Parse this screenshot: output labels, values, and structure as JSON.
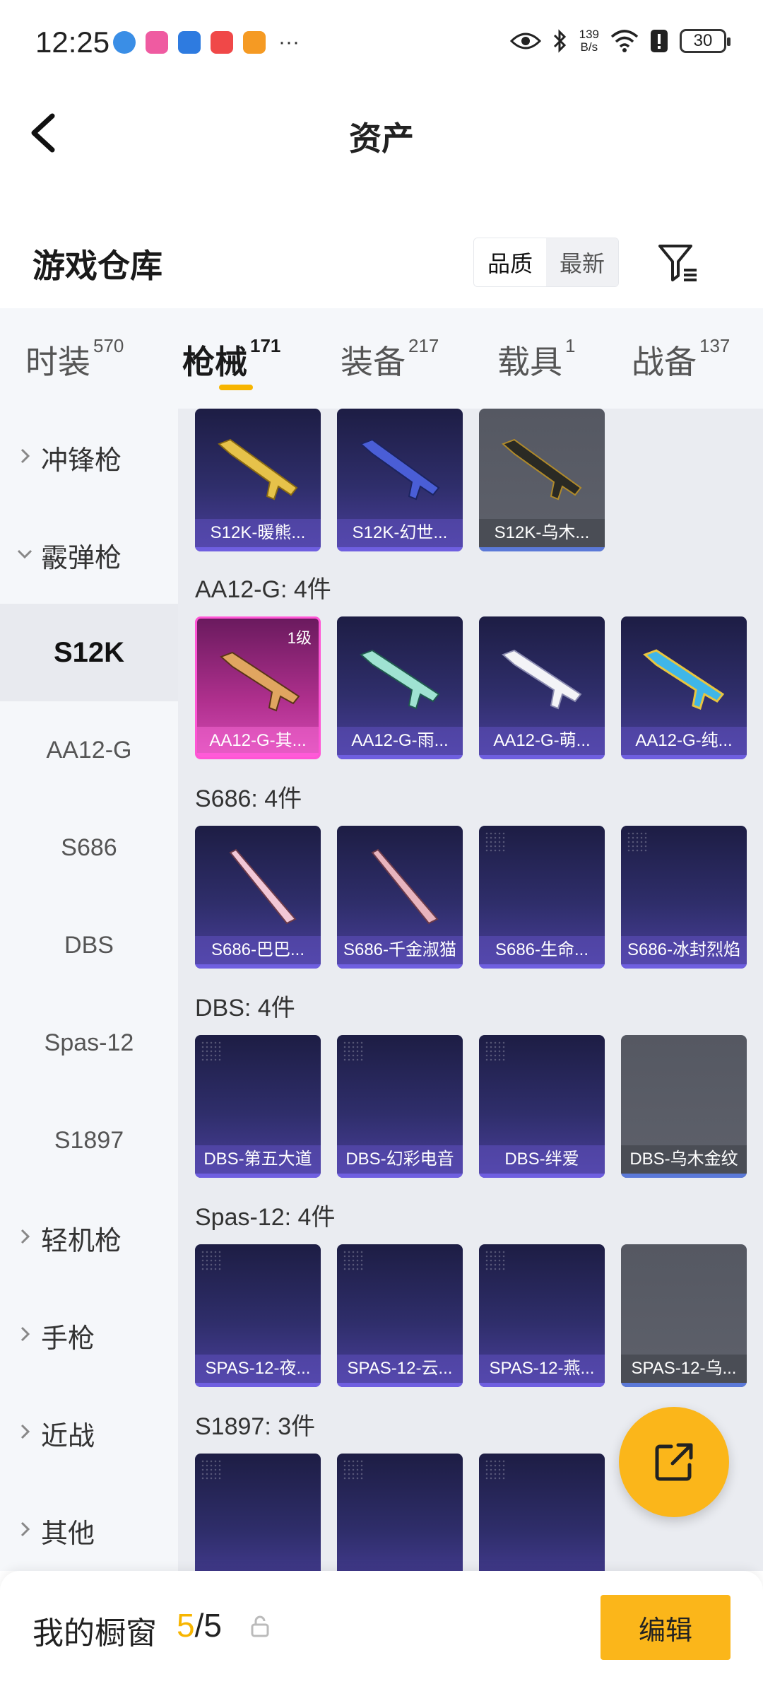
{
  "status_bar": {
    "time": "12:25",
    "network_speed": "139",
    "network_unit": "B/s",
    "battery": "30",
    "more": "···"
  },
  "header": {
    "title": "资产"
  },
  "section": {
    "title": "游戏仓库",
    "sort_options": [
      "品质",
      "最新"
    ]
  },
  "tabs": [
    {
      "label": "时装",
      "count": "570"
    },
    {
      "label": "枪械",
      "count": "171"
    },
    {
      "label": "装备",
      "count": "217"
    },
    {
      "label": "载具",
      "count": "1"
    },
    {
      "label": "战备",
      "count": "137"
    }
  ],
  "side_menu": [
    {
      "label": "冲锋枪"
    },
    {
      "label": "霰弹枪"
    },
    {
      "label": "S12K"
    },
    {
      "label": "AA12-G"
    },
    {
      "label": "S686"
    },
    {
      "label": "DBS"
    },
    {
      "label": "Spas-12"
    },
    {
      "label": "S1897"
    },
    {
      "label": "轻机枪"
    },
    {
      "label": "手枪"
    },
    {
      "label": "近战"
    },
    {
      "label": "其他"
    }
  ],
  "groups": [
    {
      "label": "",
      "items": [
        "S12K-暖熊...",
        "S12K-幻世...",
        "S12K-乌木..."
      ]
    },
    {
      "label": "AA12-G: 4件",
      "items": [
        "AA12-G-其...",
        "AA12-G-雨...",
        "AA12-G-萌...",
        "AA12-G-纯..."
      ],
      "level_badge": "1级"
    },
    {
      "label": "S686: 4件",
      "items": [
        "S686-巴巴...",
        "S686-千金淑猫",
        "S686-生命...",
        "S686-冰封烈焰"
      ]
    },
    {
      "label": "DBS: 4件",
      "items": [
        "DBS-第五大道",
        "DBS-幻彩电音",
        "DBS-绊爱",
        "DBS-乌木金纹"
      ]
    },
    {
      "label": "Spas-12: 4件",
      "items": [
        "SPAS-12-夜...",
        "SPAS-12-云...",
        "SPAS-12-燕...",
        "SPAS-12-乌..."
      ]
    },
    {
      "label": "S1897: 3件",
      "items": [
        "",
        "",
        ""
      ]
    }
  ],
  "bottom_bar": {
    "title": "我的橱窗",
    "count_current": "5",
    "count_total": "/5",
    "edit_label": "编辑"
  },
  "colors": {
    "accent": "#fbb61a",
    "card_purple": "#2f2e6b",
    "card_gray": "#5e616b",
    "card_pink": "#d54bb5"
  }
}
